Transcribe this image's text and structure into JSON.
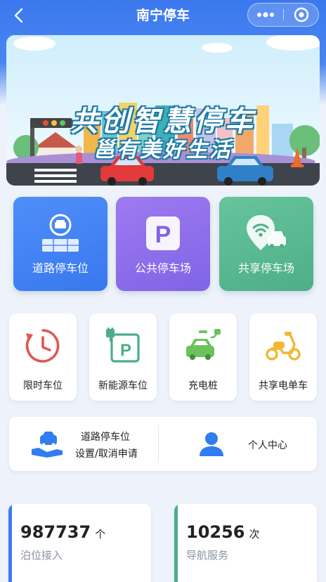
{
  "nav": {
    "title": "南宁停车",
    "back_icon": "chevron-left-icon",
    "more_icon": "more-dots-icon",
    "close_icon": "target-circle-icon"
  },
  "banner": {
    "line1": "共创智慧停车",
    "line2": "邕有美好生活"
  },
  "main_cards": [
    {
      "label": "道路停车位",
      "icon": "road-parking-icon",
      "color": "#4285f4"
    },
    {
      "label": "公共停车场",
      "icon": "parking-p-icon",
      "color": "#8c6cec"
    },
    {
      "label": "共享停车场",
      "icon": "shared-parking-icon",
      "color": "#5bb992"
    }
  ],
  "sub_cards": [
    {
      "label": "限时车位",
      "icon": "timer-icon"
    },
    {
      "label": "新能源车位",
      "icon": "ev-parking-icon"
    },
    {
      "label": "充电桩",
      "icon": "charging-car-icon"
    },
    {
      "label": "共享电单车",
      "icon": "scooter-icon"
    }
  ],
  "services": {
    "road_apply": {
      "line1": "道路停车位",
      "line2": "设置/取消申请",
      "icon": "car-hand-icon"
    },
    "personal": {
      "label": "个人中心",
      "icon": "user-icon"
    }
  },
  "stats": [
    {
      "value": "987737",
      "unit": "个",
      "caption": "泊位接入",
      "color": "#3e7bf0"
    },
    {
      "value": "10256",
      "unit": "次",
      "caption": "导航服务",
      "color": "#4cae86"
    }
  ]
}
